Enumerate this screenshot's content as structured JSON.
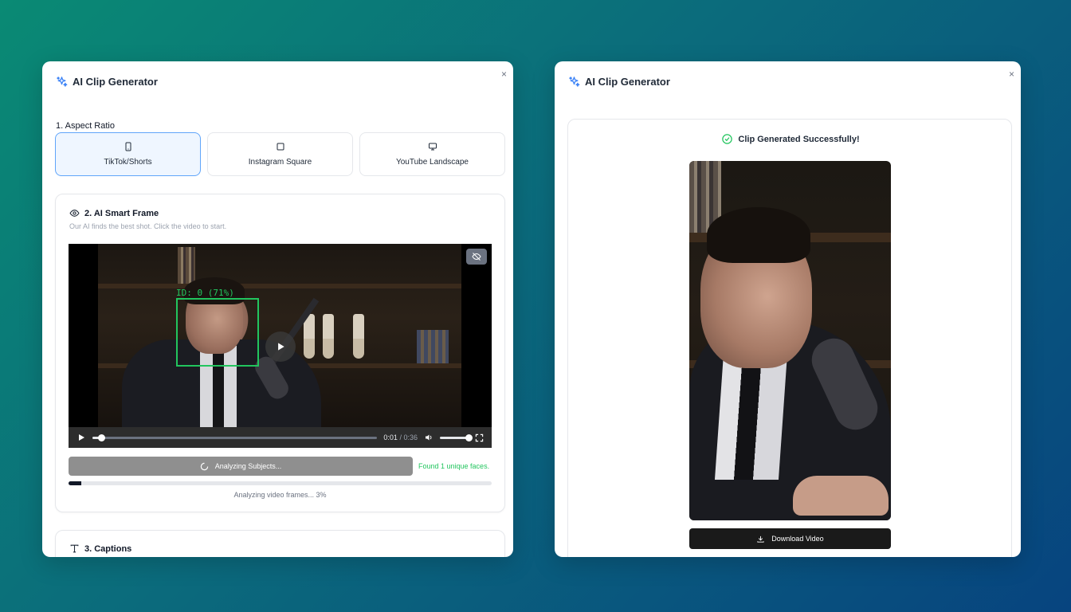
{
  "colors": {
    "accent": "#3b82f6",
    "success": "#22c55e",
    "progress": "#111827",
    "button_disabled": "#8f8f8f",
    "button_dark": "#1a1a1a"
  },
  "left_panel": {
    "title": "AI Clip Generator",
    "title_icon": "sparkles-icon",
    "close_label": "×",
    "aspect_ratio": {
      "label": "1. Aspect Ratio",
      "options": [
        {
          "label": "TikTok/Shorts",
          "icon": "smartphone-icon",
          "selected": true
        },
        {
          "label": "Instagram Square",
          "icon": "square-icon",
          "selected": false
        },
        {
          "label": "YouTube Landscape",
          "icon": "monitor-icon",
          "selected": false
        }
      ]
    },
    "smart_frame": {
      "title": "2. AI Smart Frame",
      "subtitle": "Our AI finds the best shot. Click the video to start.",
      "face_label": "ID: 0 (71%)",
      "player": {
        "current_time": "0:01",
        "separator": " / ",
        "duration": "0:36",
        "progress": 0.03,
        "volume": 1.0
      },
      "analyze_button": "Analyzing Subjects...",
      "found_text": "Found 1 unique faces.",
      "progress_percent": 3,
      "progress_text": "Analyzing video frames... 3%"
    },
    "captions": {
      "title": "3. Captions"
    }
  },
  "right_panel": {
    "title": "AI Clip Generator",
    "close_label": "×",
    "success_text": "Clip Generated Successfully!",
    "download_button": "Download Video"
  }
}
